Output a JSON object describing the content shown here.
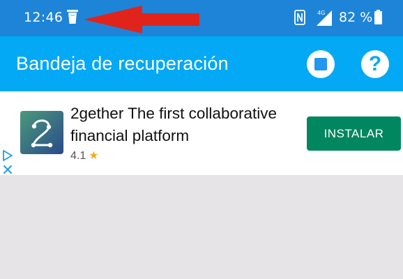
{
  "status_bar": {
    "time": "12:46",
    "battery_text": "82 %",
    "network": "4G",
    "icons": [
      "trash-icon",
      "red-arrow-annotation",
      "nfc-icon",
      "signal-4g-icon",
      "battery-icon"
    ]
  },
  "app_bar": {
    "title": "Bandeja de recuperación",
    "color": "#03a9f4",
    "buttons": [
      "stop-icon",
      "help-icon"
    ],
    "help_glyph": "?"
  },
  "ad": {
    "title": "2gether The first collaborative financial platform",
    "rating": "4.1",
    "star": "★",
    "install_label": "INSTALAR",
    "install_color": "#01875f",
    "logo_glyph": "2",
    "icons": [
      "adchoices-icon",
      "close-icon"
    ]
  },
  "colors": {
    "status_bar": "#1e84d8",
    "arrow": "#e1241b",
    "background": "#e6e4e6"
  }
}
